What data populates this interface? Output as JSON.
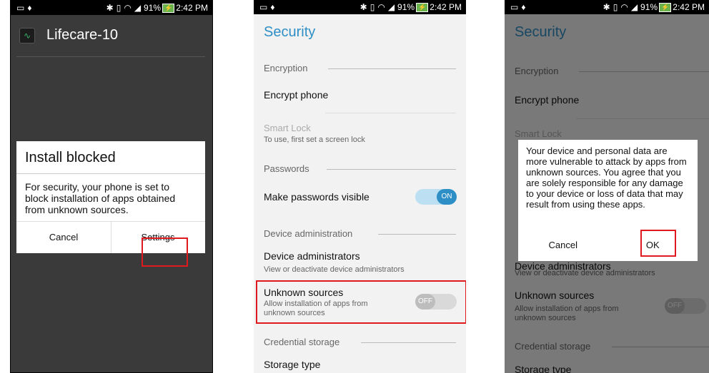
{
  "status": {
    "battery": "91%",
    "time": "2:42 PM"
  },
  "phone1": {
    "app_title": "Lifecare-10",
    "dialog": {
      "title": "Install blocked",
      "message": "For security, your phone is set to block installation of apps obtained from unknown sources.",
      "cancel": "Cancel",
      "settings": "Settings"
    }
  },
  "settings": {
    "title": "Security",
    "encryption_header": "Encryption",
    "encrypt_phone": "Encrypt phone",
    "smart_lock": "Smart Lock",
    "smart_lock_sub": "To use, first set a screen lock",
    "passwords_header": "Passwords",
    "make_passwords_visible": "Make passwords visible",
    "toggle_on": "ON",
    "device_admin_header": "Device administration",
    "device_administrators": "Device administrators",
    "device_administrators_sub": "View or deactivate device administrators",
    "unknown_sources": "Unknown sources",
    "unknown_sources_sub_1": "Allow installation of apps from",
    "unknown_sources_sub_2": "unknown sources",
    "toggle_off": "OFF",
    "credential_header": "Credential storage",
    "storage_type": "Storage type"
  },
  "phone3": {
    "message": "Your device and personal data are more vulnerable to attack by apps from unknown sources. You agree that you are solely responsible for any damage to your device or loss of data that may result from using these apps.",
    "cancel": "Cancel",
    "ok": "OK"
  },
  "colors": {
    "accent": "#2e8fc6",
    "highlight": "#e0191f",
    "dark_bg": "#3a3a3a"
  }
}
